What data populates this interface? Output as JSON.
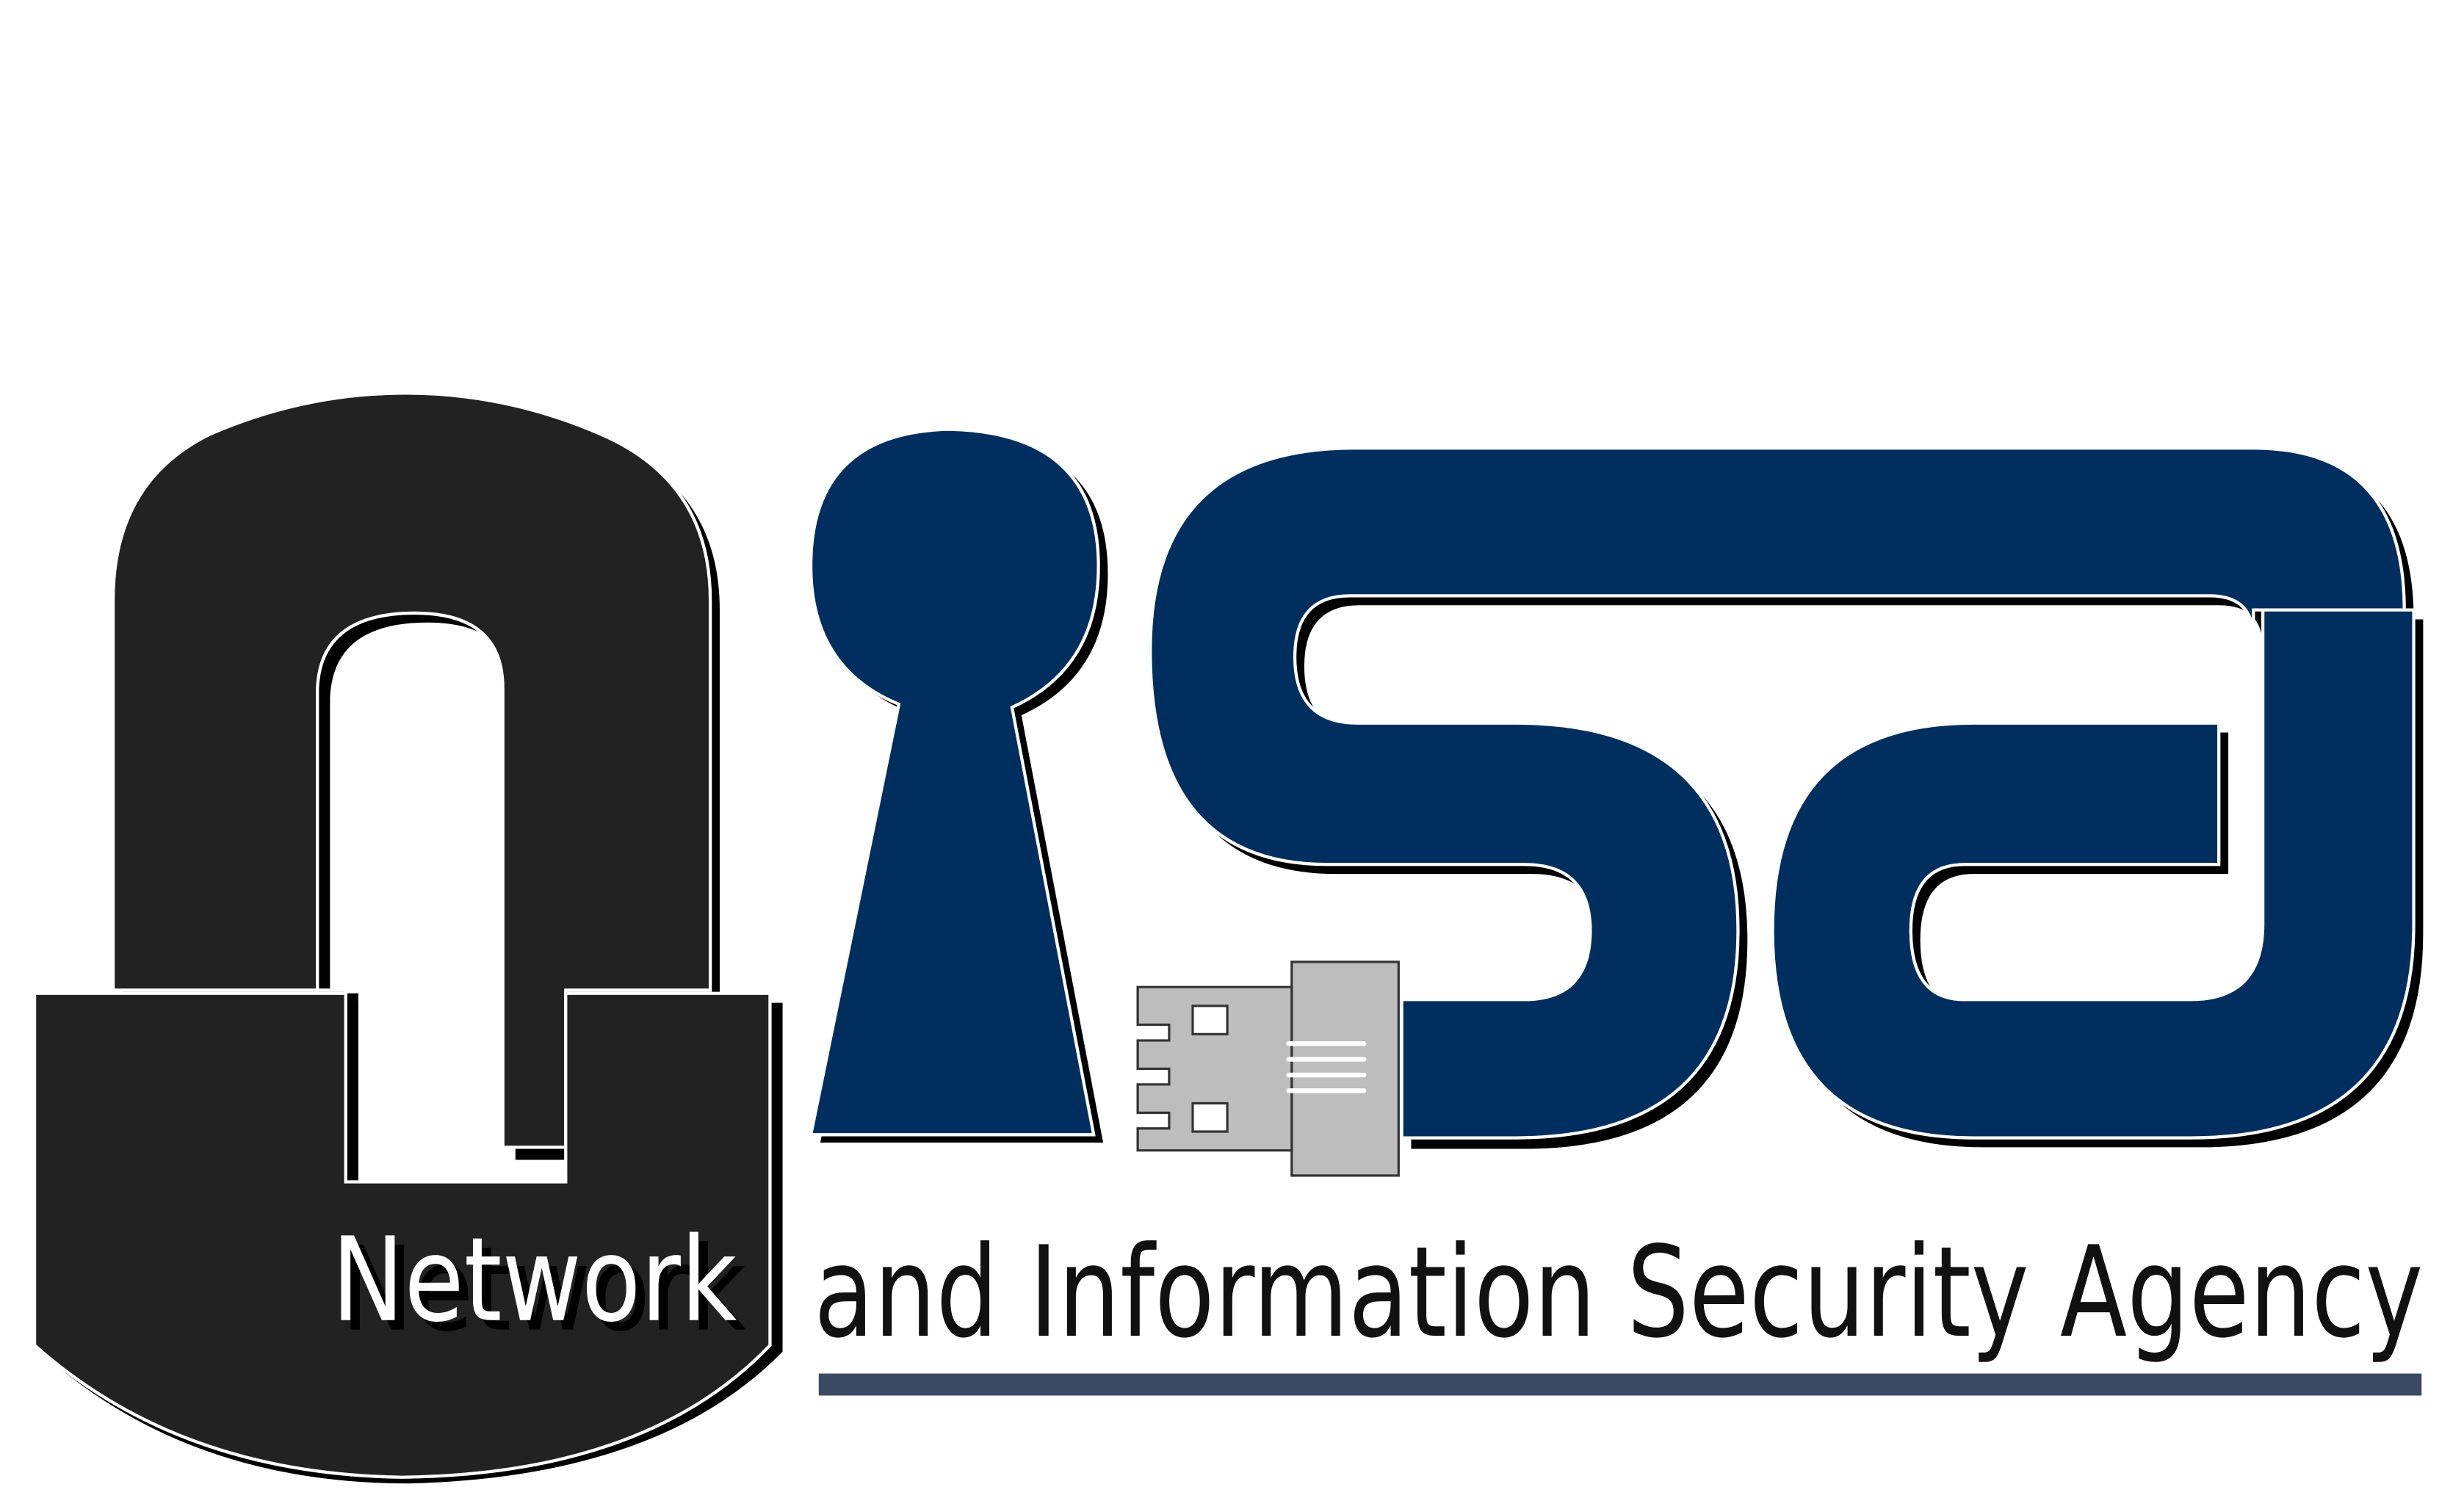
{
  "logo": {
    "name": "Network and Information Security Agency",
    "word_network": "Network",
    "word_rest": "and Information Security Agency",
    "icons": [
      "padlock-icon",
      "keyhole-icon",
      "usb-plug-icon"
    ],
    "colors": {
      "padlock": "#222222",
      "navy": "#002f5f",
      "usb_gray": "#bdbdbd",
      "underline": "#3a4a63",
      "text_dark": "#111111",
      "text_light": "#ffffff"
    }
  }
}
